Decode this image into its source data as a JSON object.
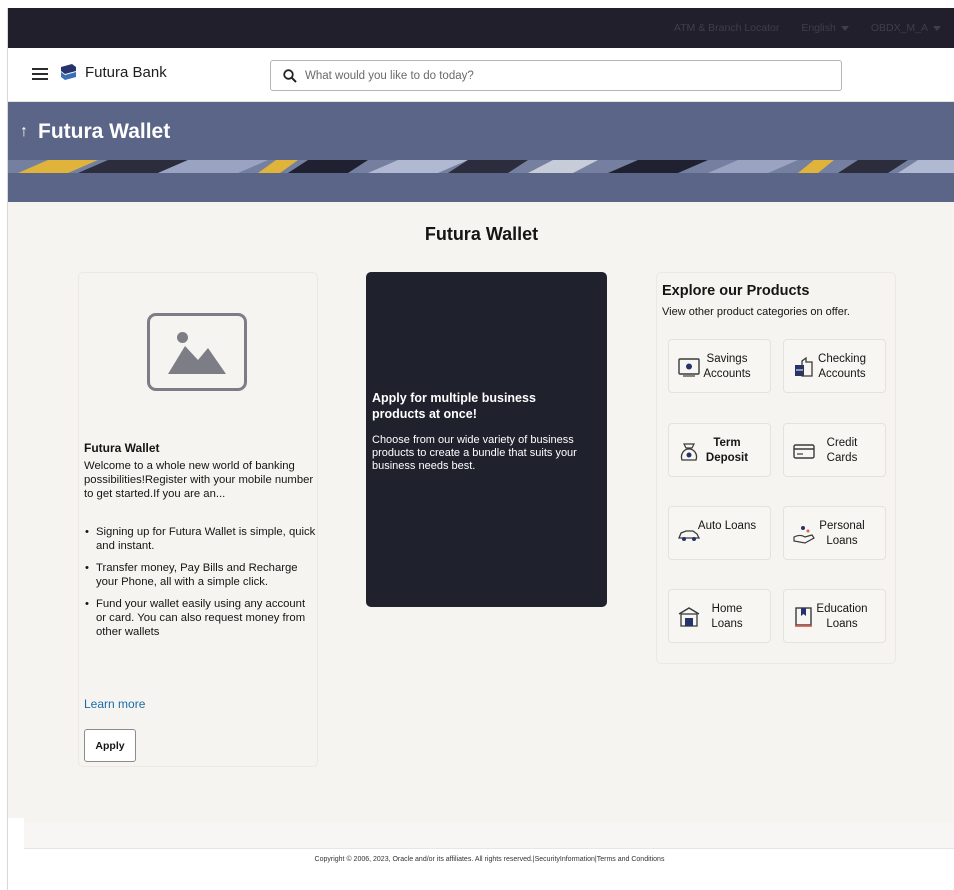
{
  "topbar": {
    "atm_locator": "ATM & Branch Locator",
    "language": "English",
    "user": "OBDX_M_A"
  },
  "header": {
    "bank_name": "Futura Bank",
    "search_placeholder": "What would you like to do today?"
  },
  "banner": {
    "back_glyph": "↑",
    "title": "Futura Wallet"
  },
  "main": {
    "title": "Futura Wallet",
    "wallet_card": {
      "title": "Futura Wallet",
      "description": "Welcome to a whole new world of banking possibilities!Register with your mobile number to get started.If you are an...",
      "bullets": [
        "Signing up for Futura Wallet is simple, quick and instant.",
        "Transfer money, Pay Bills and Recharge your Phone, all with a simple click.",
        "Fund your wallet easily using any account or card. You can also request money from other wallets"
      ],
      "learn_more": "Learn more",
      "apply": "Apply"
    },
    "promo_card": {
      "title": "Apply for multiple business products at once!",
      "description": "Choose from our wide variety of business products to create a bundle that suits your business needs best."
    },
    "products": {
      "title": "Explore our Products",
      "subtitle": "View other product categories on offer.",
      "items": [
        {
          "label": "Savings Accounts",
          "icon": "savings-icon"
        },
        {
          "label": "Checking Accounts",
          "icon": "checking-icon"
        },
        {
          "label": "Term Deposit",
          "icon": "term-deposit-icon"
        },
        {
          "label": "Credit Cards",
          "icon": "credit-card-icon"
        },
        {
          "label": "Auto Loans",
          "icon": "auto-loan-icon"
        },
        {
          "label": "Personal Loans",
          "icon": "personal-loan-icon"
        },
        {
          "label": "Home Loans",
          "icon": "home-loan-icon"
        },
        {
          "label": "Education Loans",
          "icon": "education-loan-icon"
        }
      ]
    }
  },
  "footer": {
    "copyright": "Copyright © 2006, 2023, Oracle and/or its affiliates. All rights reserved.|SecurityInformation|Terms and Conditions"
  },
  "colors": {
    "top_strip": "#201f2b",
    "banner": "#5b6587",
    "promo_card": "#1f212c",
    "link": "#1b6ca8"
  }
}
